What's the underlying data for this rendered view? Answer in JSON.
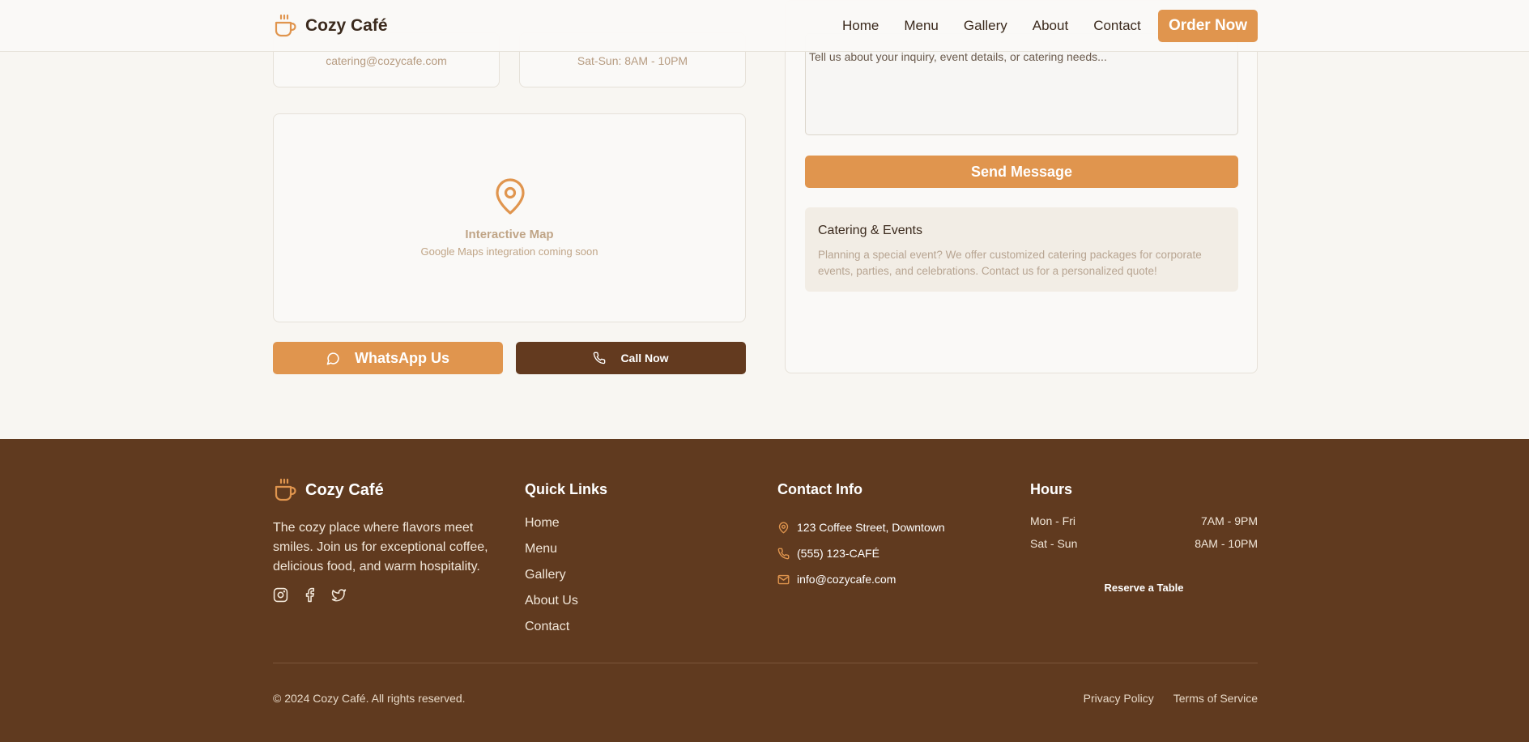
{
  "nav": {
    "brand": "Cozy Café",
    "links": [
      "Home",
      "Menu",
      "Gallery",
      "About",
      "Contact"
    ],
    "order_button": "Order Now"
  },
  "contact_cards": [
    {
      "value": "catering@cozycafe.com"
    },
    {
      "value": "Sat-Sun: 8AM - 10PM"
    }
  ],
  "map": {
    "title": "Interactive Map",
    "subtitle": "Google Maps integration coming soon"
  },
  "actions": {
    "whatsapp": "WhatsApp Us",
    "call": "Call Now"
  },
  "form": {
    "message_placeholder": "Tell us about your inquiry, event details, or catering needs...",
    "send_button": "Send Message"
  },
  "catering": {
    "title": "Catering & Events",
    "text": "Planning a special event? We offer customized catering packages for corporate events, parties, and celebrations. Contact us for a personalized quote!"
  },
  "footer": {
    "brand": "Cozy Café",
    "description": "The cozy place where flavors meet smiles. Join us for exceptional coffee, delicious food, and warm hospitality.",
    "social_icons": [
      "instagram-icon",
      "facebook-icon",
      "twitter-icon"
    ],
    "quick_links_title": "Quick Links",
    "quick_links": [
      "Home",
      "Menu",
      "Gallery",
      "About Us",
      "Contact"
    ],
    "contact_title": "Contact Info",
    "address": "123 Coffee Street, Downtown",
    "phone": "(555) 123-CAFÉ",
    "email": "info@cozycafe.com",
    "hours_title": "Hours",
    "hours": [
      {
        "days": "Mon - Fri",
        "time": "7AM - 9PM"
      },
      {
        "days": "Sat - Sun",
        "time": "8AM - 10PM"
      }
    ],
    "reserve": "Reserve a Table",
    "copyright": "© 2024 Cozy Café. All rights reserved.",
    "privacy": "Privacy Policy",
    "terms": "Terms of Service"
  },
  "colors": {
    "accent": "#e0954e",
    "brown": "#603a1f",
    "background": "#f8f6f2"
  }
}
